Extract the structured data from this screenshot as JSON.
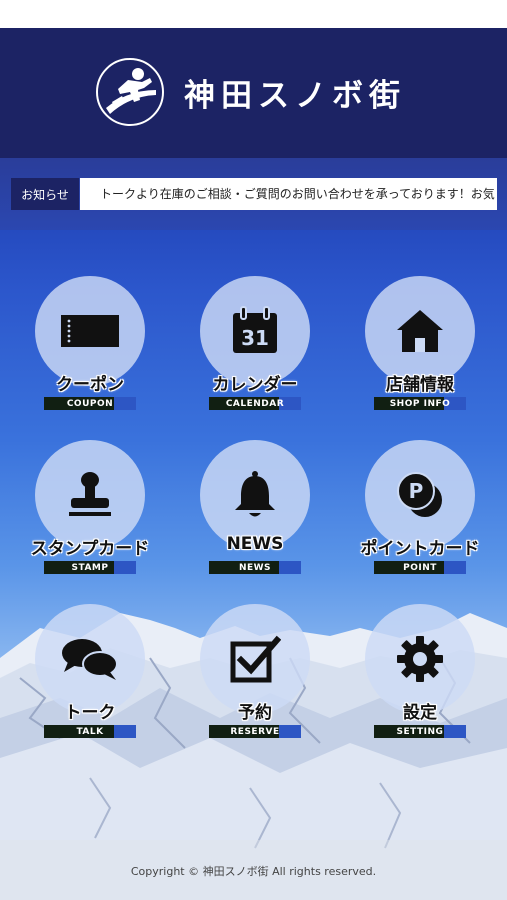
{
  "app": {
    "title": "神田スノボ街"
  },
  "ticker": {
    "label": "お知らせ",
    "text": "トークより在庫のご相談・ご質問のお問い合わせを承っております！お気"
  },
  "menu": [
    {
      "label": "クーポン",
      "sub": "COUPON",
      "icon": "coupon-icon"
    },
    {
      "label": "カレンダー",
      "sub": "CALENDAR",
      "icon": "calendar-icon",
      "calendar_day": "31"
    },
    {
      "label": "店舗情報",
      "sub": "SHOP INFO",
      "icon": "home-icon"
    },
    {
      "label": "スタンプカード",
      "sub": "STAMP",
      "icon": "stamp-icon"
    },
    {
      "label": "NEWS",
      "sub": "NEWS",
      "icon": "bell-icon"
    },
    {
      "label": "ポイントカード",
      "sub": "POINT",
      "icon": "point-coin-icon",
      "point_letter": "P"
    },
    {
      "label": "トーク",
      "sub": "TALK",
      "icon": "chat-bubbles-icon"
    },
    {
      "label": "予約",
      "sub": "RESERVE",
      "icon": "checkbox-icon"
    },
    {
      "label": "設定",
      "sub": "SETTING",
      "icon": "gear-icon"
    }
  ],
  "footer": {
    "copyright": "Copyright © 神田スノボ街 All rights reserved."
  },
  "colors": {
    "header_bg": "#1c2364",
    "sub_label_dark": "#111f12",
    "sub_label_blue": "#2d56c4",
    "circle_fill": "#cddbf5"
  }
}
